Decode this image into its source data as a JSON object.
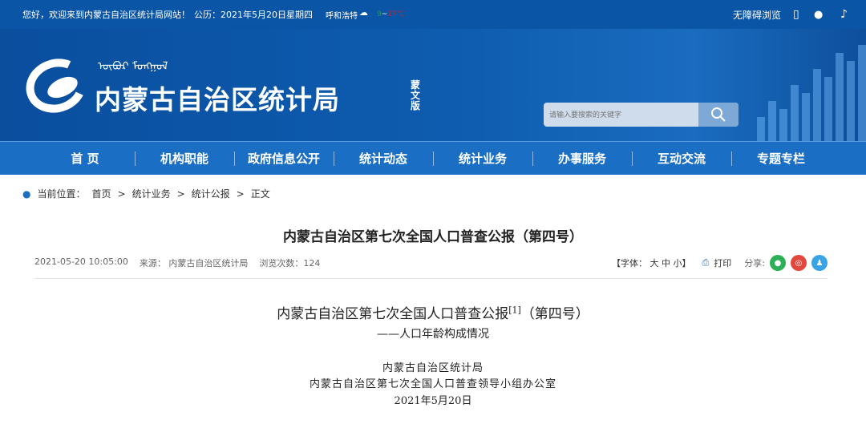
{
  "topbar": {
    "welcome": "您好，欢迎来到内蒙古自治区统计局网站！",
    "date": "公历：2021年5月20日星期四",
    "city": "呼和浩特",
    "temp_low": "9",
    "temp_sep": "~",
    "temp_high": "17℃",
    "accessibility": "无障碍浏览"
  },
  "header": {
    "site_title": "内蒙古自治区统计局",
    "mongolian_link": "蒙文版",
    "search_placeholder": "请输入要搜索的关键字"
  },
  "nav": [
    "首 页",
    "机构职能",
    "政府信息公开",
    "统计动态",
    "统计业务",
    "办事服务",
    "互动交流",
    "专题专栏"
  ],
  "breadcrumb": {
    "label": "当前位置：",
    "items": [
      "首页",
      "统计业务",
      "统计公报",
      "正文"
    ],
    "sep": ">"
  },
  "article": {
    "title": "内蒙古自治区第七次全国人口普查公报（第四号）",
    "datetime": "2021-05-20 10:05:00",
    "source": "来源：  内蒙古自治区统计局",
    "views": "浏览次数：124",
    "font_label": "【字体：",
    "font_large": "大",
    "font_medium": "中",
    "font_small": "小】",
    "print": "打印",
    "share": "分享:",
    "heading": "内蒙古自治区第七次全国人口普查公报",
    "footnote": "[1]",
    "heading_suffix": "（第四号）",
    "subtitle": "——人口年龄构成情况",
    "org1": "内蒙古自治区统计局",
    "org2": "内蒙古自治区第七次全国人口普查领导小组办公室",
    "pub_date": "2021年5月20日"
  }
}
